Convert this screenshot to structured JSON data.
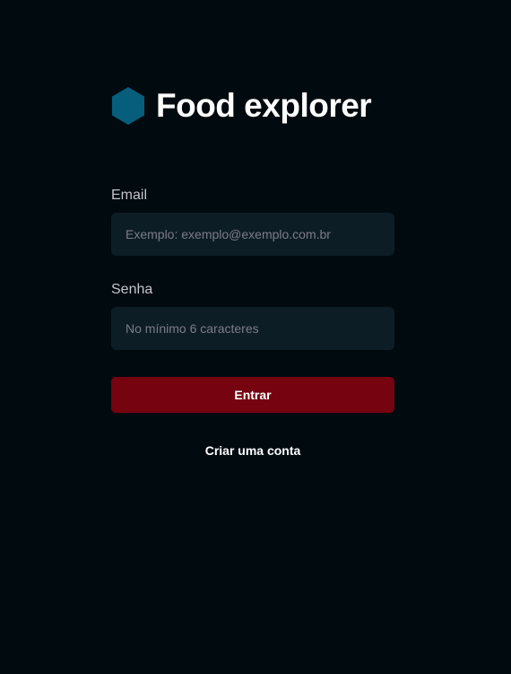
{
  "brand": {
    "title": "Food explorer",
    "logo_icon": "hexagon-icon",
    "logo_color": "#065E7C"
  },
  "form": {
    "email": {
      "label": "Email",
      "placeholder": "Exemplo: exemplo@exemplo.com.br",
      "value": ""
    },
    "password": {
      "label": "Senha",
      "placeholder": "No mínimo 6 caracteres",
      "value": ""
    },
    "submit_label": "Entrar",
    "create_account_label": "Criar uma conta"
  },
  "colors": {
    "background": "#000A0F",
    "input_background": "#0D1D25",
    "button": "#750310",
    "text": "#FFFFFF",
    "label": "#C4C4CC",
    "placeholder": "#7C7C8A"
  }
}
